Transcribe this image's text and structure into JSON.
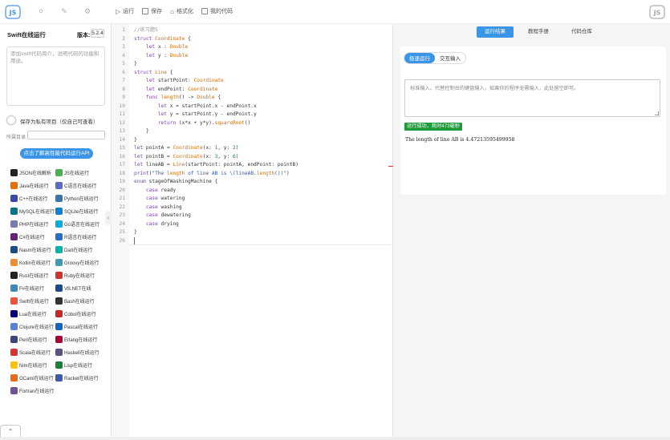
{
  "toolbar": {
    "run": "运行",
    "save": "保存",
    "format": "格式化",
    "mycode": "我的代码"
  },
  "sidebar": {
    "title": "Swift在线运行",
    "version_label": "版本:",
    "version": "5.2.4",
    "desc_placeholder": "添加swift代码简介，说明代码的功能和用途。",
    "private_label": "保存为私有项目（仅自己可查看）",
    "dir_label": "所属目录",
    "api_button": "点击了解高性能代码运行API",
    "langs": [
      {
        "label": "JSON在线解析",
        "color": "#222"
      },
      {
        "label": "JS在线运行",
        "color": "#4caf50"
      },
      {
        "label": "Java在线运行",
        "color": "#e76f00"
      },
      {
        "label": "C语言在线运行",
        "color": "#5c6bc0"
      },
      {
        "label": "C++在线运行",
        "color": "#3949ab"
      },
      {
        "label": "Python在线运行",
        "color": "#3776ab"
      },
      {
        "label": "MySQL在线运行",
        "color": "#00758f"
      },
      {
        "label": "SQLite在线运行",
        "color": "#0f80cc"
      },
      {
        "label": "PHP在线运行",
        "color": "#777bb4"
      },
      {
        "label": "Go语言在线运行",
        "color": "#00add8"
      },
      {
        "label": "C#在线运行",
        "color": "#68217a"
      },
      {
        "label": "R语言在线运行",
        "color": "#276dc3"
      },
      {
        "label": "Nasm在线运行",
        "color": "#1a4c8a"
      },
      {
        "label": "Dart在线运行",
        "color": "#00b4ab"
      },
      {
        "label": "Kotlin在线运行",
        "color": "#f18e33"
      },
      {
        "label": "Groovy在线运行",
        "color": "#4298b8"
      },
      {
        "label": "Rust在线运行",
        "color": "#222"
      },
      {
        "label": "Ruby在线运行",
        "color": "#cc342d"
      },
      {
        "label": "F#在线运行",
        "color": "#378bba"
      },
      {
        "label": "VB.NET在线",
        "color": "#1b4b8a"
      },
      {
        "label": "Swift在线运行",
        "color": "#f05138"
      },
      {
        "label": "Bash在线运行",
        "color": "#333"
      },
      {
        "label": "Lua在线运行",
        "color": "#000080"
      },
      {
        "label": "Cobol在线运行",
        "color": "#c62828"
      },
      {
        "label": "Clojure在线运行",
        "color": "#5881d8"
      },
      {
        "label": "Pascal在线运行",
        "color": "#1565c0"
      },
      {
        "label": "Perl在线运行",
        "color": "#39457e"
      },
      {
        "label": "Erlang在线运行",
        "color": "#a90533"
      },
      {
        "label": "Scala在线运行",
        "color": "#dc322f"
      },
      {
        "label": "Haskell在线运行",
        "color": "#5e5086"
      },
      {
        "label": "Nim在线运行",
        "color": "#ffc200"
      },
      {
        "label": "Lisp在线运行",
        "color": "#1a7f37"
      },
      {
        "label": "OCaml在线运行",
        "color": "#ec6813"
      },
      {
        "label": "Racket在线运行",
        "color": "#3e5ba9"
      },
      {
        "label": "Fortran在线运行",
        "color": "#734f96"
      }
    ]
  },
  "editor": {
    "lines": [
      "//练习题5",
      "struct Coordinate {",
      "    let x : Double",
      "    let y : Double",
      "}",
      "struct Line {",
      "    let startPoint: Coordinate",
      "    let endPoint: Coordinate",
      "    func length() -> Double {",
      "        let x = startPoint.x - endPoint.x",
      "        let y = startPoint.y - endPoint.y",
      "        return (x*x + y*y).squareRoot()",
      "    }",
      "}",
      "let pointA = Coordinate(x: 1, y: 2)",
      "let pointB = Coordinate(x: 3, y: 6)",
      "let lineAB = Line(startPoint: pointA, endPoint: pointB)",
      "print(\"The length of line AB is \\(lineAB.length())\")",
      "enum stageOfWashingMachine {",
      "    case ready",
      "    case watering",
      "    case washing",
      "    case dewatering",
      "    case drying",
      "}",
      ""
    ]
  },
  "right": {
    "tabs": [
      "运行结果",
      "教程手册",
      "代码仓库"
    ],
    "subtabs": [
      "极速运行",
      "交互输入"
    ],
    "stdin_placeholder": "标准输入、代替控制台的键盘输入，如果你的程序无需输入，此处留空即可。",
    "success": "运行成功，耗时473毫秒",
    "output": "The length of line AB is 4.47213595499958"
  },
  "colors": {
    "accent": "#3a95e8",
    "success": "#1e9a3a"
  }
}
